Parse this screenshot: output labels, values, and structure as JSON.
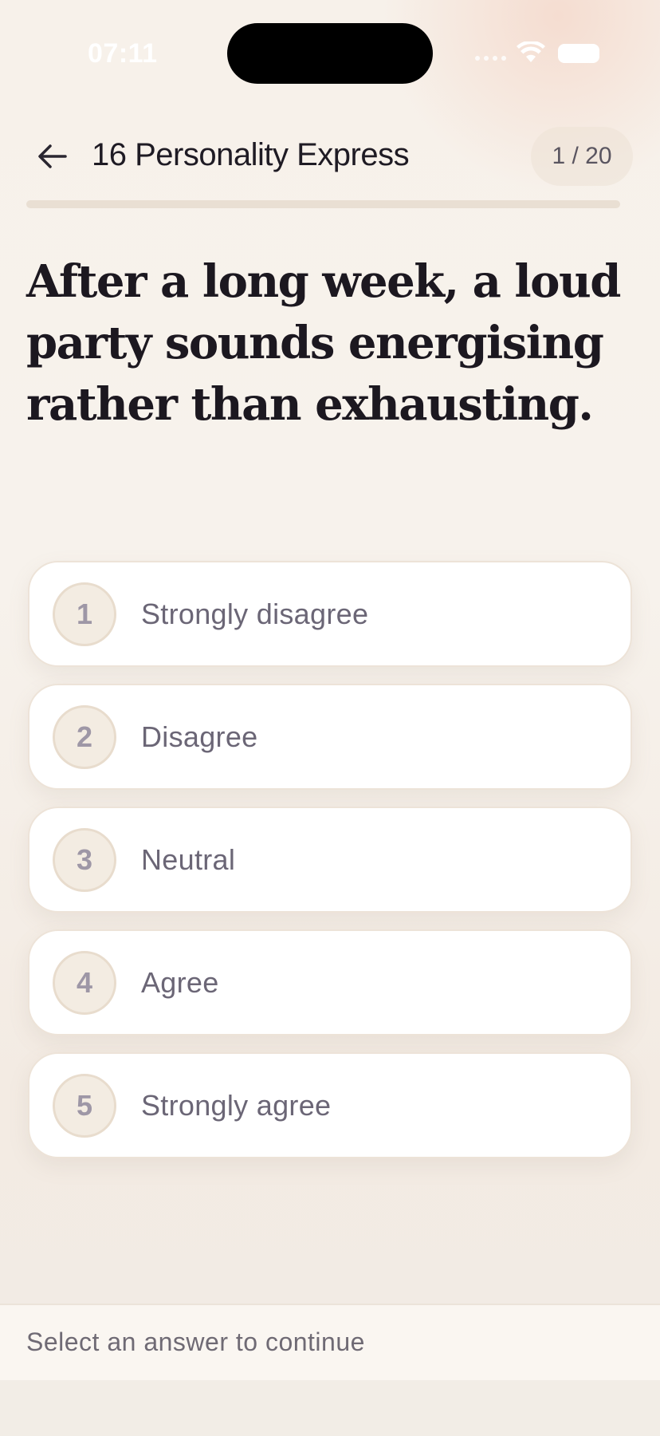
{
  "status_bar": {
    "time": "07:11"
  },
  "header": {
    "title": "16 Personality Express",
    "counter": "1 / 20",
    "progress_fraction": 0.0
  },
  "question": {
    "text": "After a long week, a loud party sounds energising rather than exhausting."
  },
  "options": [
    {
      "number": "1",
      "label": "Strongly disagree"
    },
    {
      "number": "2",
      "label": "Disagree"
    },
    {
      "number": "3",
      "label": "Neutral"
    },
    {
      "number": "4",
      "label": "Agree"
    },
    {
      "number": "5",
      "label": "Strongly agree"
    }
  ],
  "footer": {
    "hint": "Select an answer to continue"
  },
  "colors": {
    "background": "#f7f1ea",
    "card": "#ffffff",
    "text_primary": "#1c1820",
    "text_secondary": "#6b6676",
    "number_circle": "#f3ece2"
  },
  "icons": {
    "back": "arrow-left-icon",
    "wifi": "wifi-icon",
    "battery": "battery-icon"
  }
}
